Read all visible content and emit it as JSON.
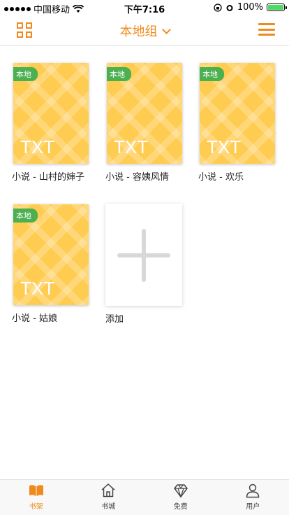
{
  "status": {
    "carrier": "中国移动",
    "time": "下午7:16",
    "battery": "100%"
  },
  "nav": {
    "title": "本地组"
  },
  "books": [
    {
      "badge": "本地",
      "ext": "TXT",
      "title": "小说 - 山村的婶子"
    },
    {
      "badge": "本地",
      "ext": "TXT",
      "title": "小说 - 容姨风情"
    },
    {
      "badge": "本地",
      "ext": "TXT",
      "title": "小说 - 欢乐"
    },
    {
      "badge": "本地",
      "ext": "TXT",
      "title": "小说 - 姑娘"
    }
  ],
  "add": {
    "label": "添加"
  },
  "tabs": [
    {
      "label": "书架",
      "icon": "book-open-icon",
      "active": true
    },
    {
      "label": "书城",
      "icon": "house-icon"
    },
    {
      "label": "免费",
      "icon": "diamond-icon"
    },
    {
      "label": "用户",
      "icon": "user-icon"
    }
  ],
  "colors": {
    "accent": "#f08a1d",
    "cover": "#ffcc52",
    "badge": "#4caf50"
  }
}
